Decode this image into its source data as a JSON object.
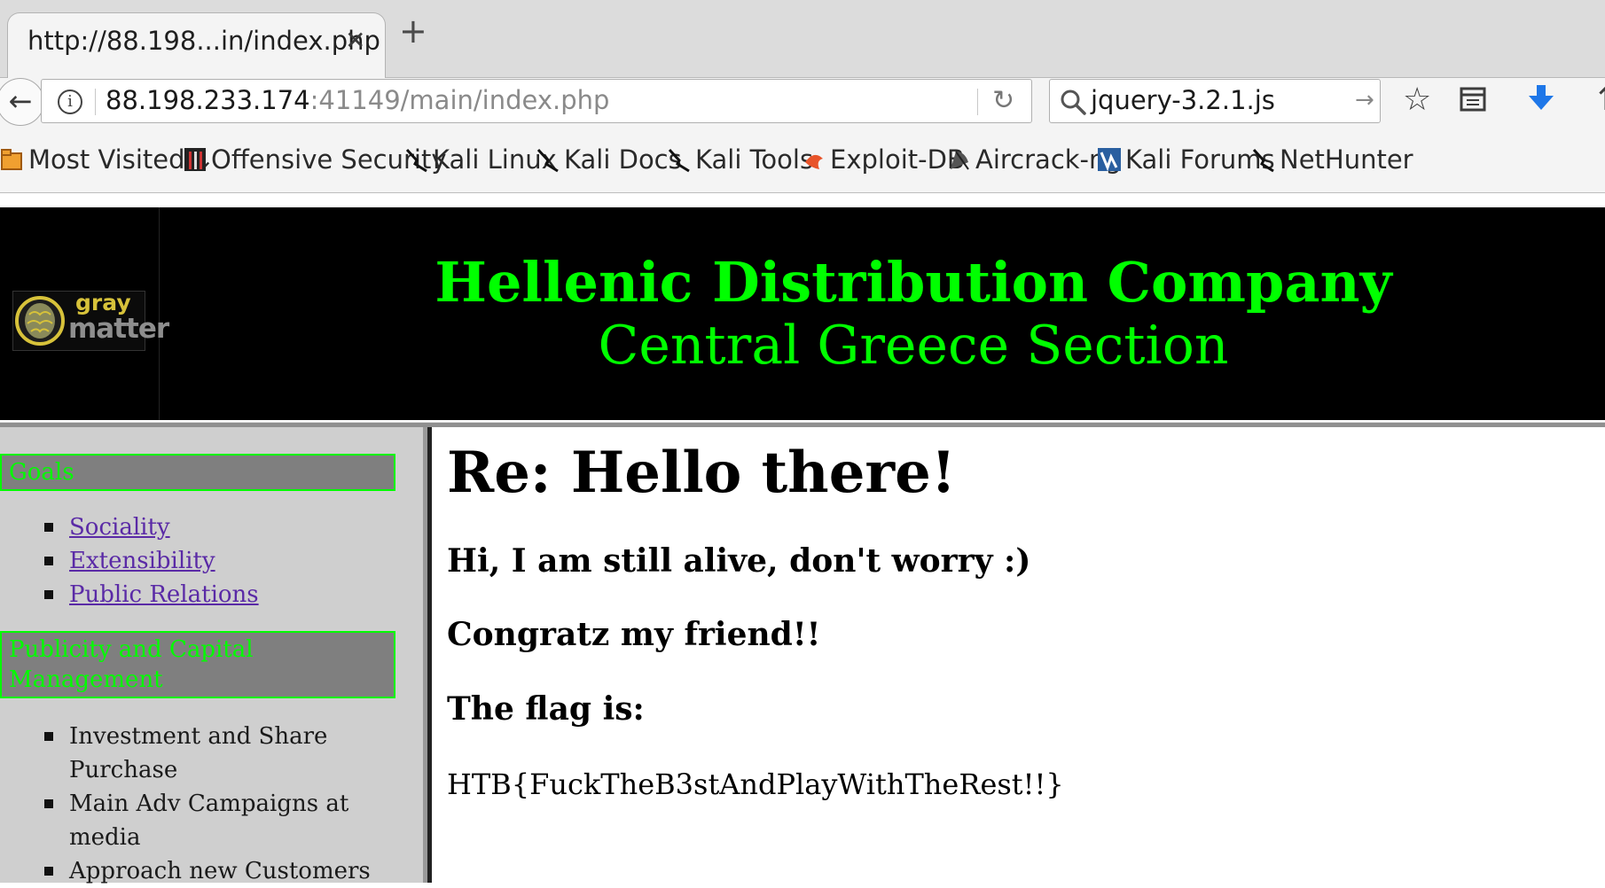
{
  "browser": {
    "tab_title": "http://88.198...in/index.php",
    "tab_close": "✕",
    "new_tab": "+",
    "back": "←",
    "url_host": "88.198.233.174",
    "url_rest": ":41149/main/index.php",
    "reload": "↻",
    "search_value": "jquery-3.2.1.js",
    "search_go": "→",
    "toolbar_icons": [
      "bookmark-star-icon",
      "library-icon",
      "download-icon",
      "overflow-icon"
    ],
    "bookmarks": [
      {
        "label": "Most Visited",
        "icon": "most-visited-icon",
        "dropdown": true
      },
      {
        "label": "Offensive Security",
        "icon": "offensive-security-icon"
      },
      {
        "label": "Kali Linux",
        "icon": "kali-icon"
      },
      {
        "label": "Kali Docs",
        "icon": "kali-icon"
      },
      {
        "label": "Kali Tools",
        "icon": "kali-icon"
      },
      {
        "label": "Exploit-DB",
        "icon": "exploit-db-icon"
      },
      {
        "label": "Aircrack-ng",
        "icon": "aircrack-icon"
      },
      {
        "label": "Kali Forums",
        "icon": "kali-forums-icon"
      },
      {
        "label": "NetHunter",
        "icon": "kali-icon"
      }
    ]
  },
  "site": {
    "logo_top": "gray",
    "logo_bottom": "matter",
    "title": "Hellenic Distribution Company",
    "subtitle": "Central Greece Section",
    "accent_color": "#00ff00"
  },
  "sidebar": {
    "goals_heading": "Goals",
    "goals_links": [
      "Sociality",
      "Extensibility",
      "Public Relations"
    ],
    "publicity_heading": "Publicity and Capital Management",
    "publicity_items": [
      "Investment and Share Purchase",
      "Main Adv Campaigns at media",
      "Approach new Customers"
    ]
  },
  "post": {
    "title": "Re: Hello there!",
    "line1": "Hi, I am still alive, don't worry :)",
    "line2": "Congratz my friend!!",
    "line3": "The flag is:",
    "flag": "HTB{FuckTheB3stAndPlayWithTheRest!!}"
  }
}
